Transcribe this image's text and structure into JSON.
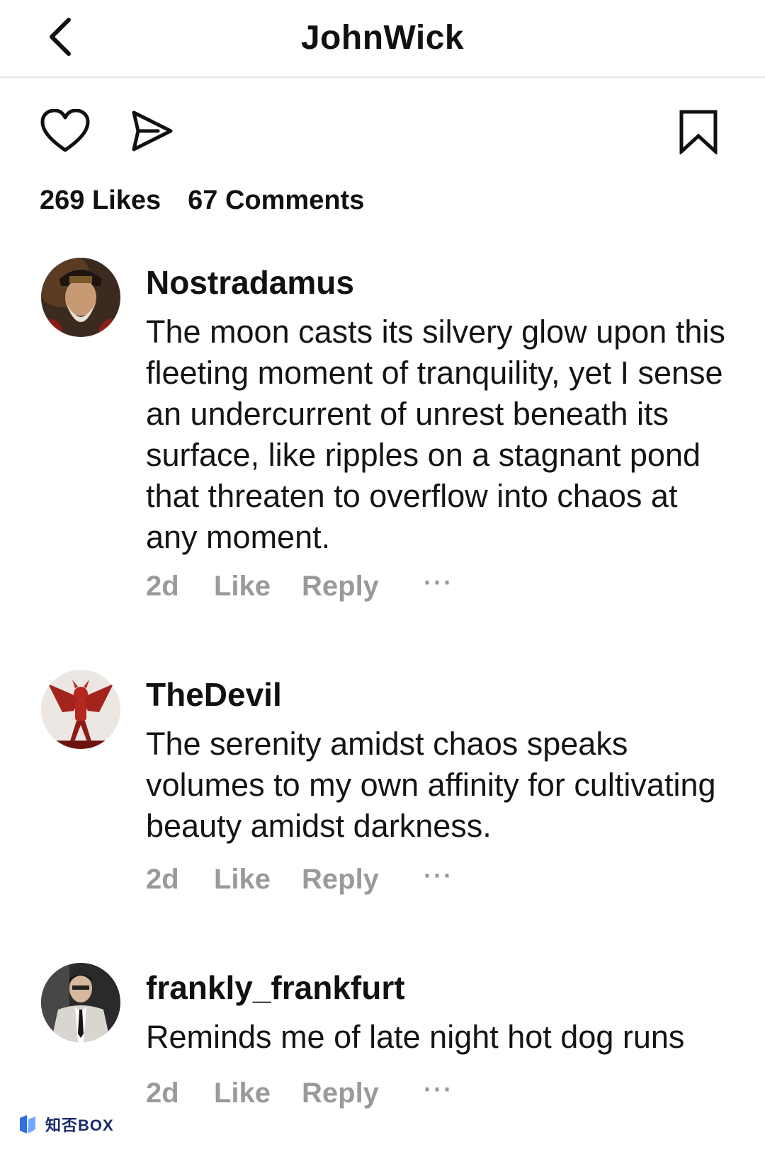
{
  "header": {
    "title": "JohnWick"
  },
  "actions": {
    "like_icon": "heart-icon",
    "share_icon": "send-icon",
    "save_icon": "bookmark-icon"
  },
  "stats": {
    "likes": "269 Likes",
    "comments": "67 Comments"
  },
  "comments": [
    {
      "username": "Nostradamus",
      "text": "The moon casts its silvery glow upon this fleeting moment of tranquility, yet I sense an undercurrent of unrest beneath its surface, like ripples on a stagnant pond that threaten to overflow into chaos at any moment.",
      "time": "2d",
      "like_label": "Like",
      "reply_label": "Reply",
      "more_label": "···"
    },
    {
      "username": "TheDevil",
      "text": "The serenity amidst chaos speaks volumes to my own affinity for cultivating beauty amidst darkness.",
      "time": "2d",
      "like_label": "Like",
      "reply_label": "Reply",
      "more_label": "···"
    },
    {
      "username": "frankly_frankfurt",
      "text": "Reminds me of late night hot dog runs",
      "time": "2d",
      "like_label": "Like",
      "reply_label": "Reply",
      "more_label": "···"
    }
  ],
  "watermark": {
    "text": "知否BOX"
  },
  "colors": {
    "meta_gray": "#9a9a9a",
    "text": "#111111",
    "divider": "#e6e6e6"
  }
}
